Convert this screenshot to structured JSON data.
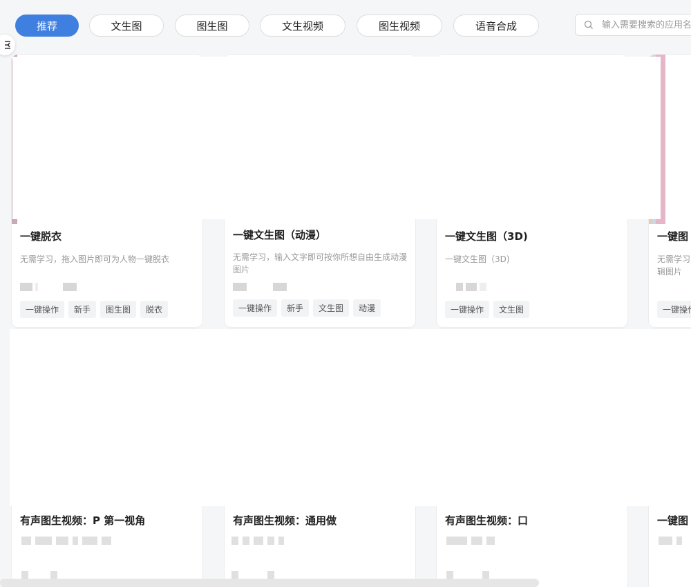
{
  "filters": [
    {
      "label": "推荐",
      "active": true
    },
    {
      "label": "文生图",
      "active": false
    },
    {
      "label": "图生图",
      "active": false
    },
    {
      "label": "文生视频",
      "active": false
    },
    {
      "label": "图生视频",
      "active": false
    },
    {
      "label": "语音合成",
      "active": false
    }
  ],
  "search": {
    "placeholder": "输入需要搜索的应用名称"
  },
  "cards_row1": [
    {
      "title": "一键脱衣",
      "desc": "无需学习，拖入图片即可为人物一键脱衣",
      "tags": [
        "一键操作",
        "新手",
        "图生图",
        "脱衣"
      ]
    },
    {
      "title": "一键文生图（动漫）",
      "desc": "无需学习，输入文字即可按你所想自由生成动漫图片",
      "tags": [
        "一键操作",
        "新手",
        "文生图",
        "动漫"
      ]
    },
    {
      "title": "一键文生图（3D)",
      "desc": "一键文生图（3D)",
      "tags": [
        "一键操作",
        "文生图"
      ]
    },
    {
      "title": "一键图",
      "desc": "无需学习辑图片",
      "tags": [
        "一键操作"
      ]
    }
  ],
  "cards_row2": [
    {
      "title": "有声图生视频：P 第一视角"
    },
    {
      "title": "有声图生视频：通用做"
    },
    {
      "title": "有声图生视频：口"
    },
    {
      "title": "一键图"
    }
  ],
  "colors": {
    "accent": "#3f7fe0"
  }
}
